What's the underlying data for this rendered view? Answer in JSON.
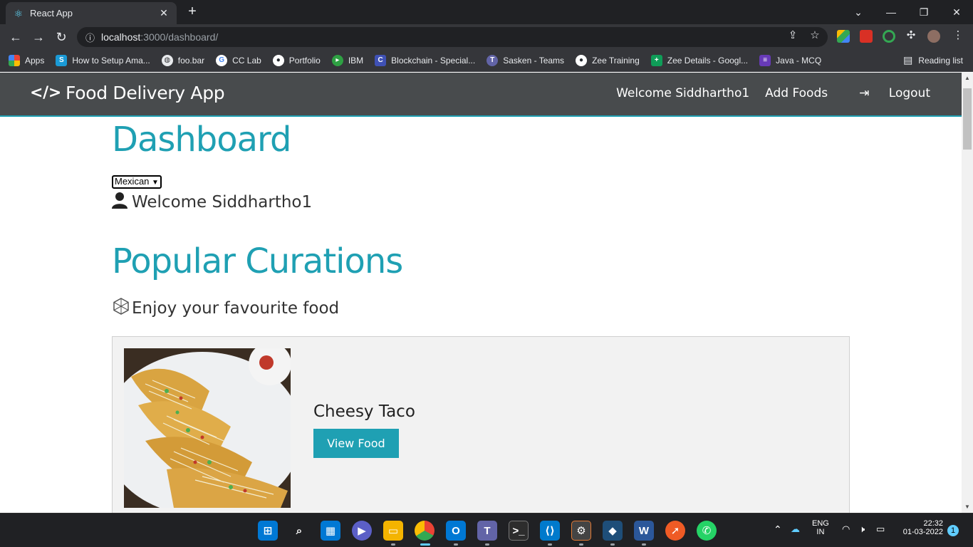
{
  "browser": {
    "tab_title": "React App",
    "tab_close": "✕",
    "new_tab": "+",
    "url_host": "localhost",
    "url_rest": ":3000/dashboard/",
    "bookmarks": [
      {
        "label": "Apps",
        "color": "#ea4335"
      },
      {
        "label": "How to Setup Ama...",
        "color": "#1a9ad6"
      },
      {
        "label": "foo.bar",
        "color": "#5f6368"
      },
      {
        "label": "CC Lab",
        "color": "#4285f4"
      },
      {
        "label": "Portfolio",
        "color": "#24292e"
      },
      {
        "label": "IBM",
        "color": "#2ea043"
      },
      {
        "label": "Blockchain - Special...",
        "color": "#3f51b5"
      },
      {
        "label": "Sasken - Teams",
        "color": "#6264a7"
      },
      {
        "label": "Zee Training",
        "color": "#24292e"
      },
      {
        "label": "Zee Details - Googl...",
        "color": "#0f9d58"
      },
      {
        "label": "Java - MCQ",
        "color": "#673ab7"
      }
    ],
    "reading_list": "Reading list"
  },
  "app": {
    "brand": "Food Delivery App",
    "brand_icon": "</>",
    "nav": {
      "welcome": "Welcome Siddhartho1",
      "add_foods": "Add Foods",
      "logout": "Logout"
    }
  },
  "dashboard": {
    "title": "Dashboard",
    "cuisine_selected": "Mexican",
    "welcome": "Welcome Siddhartho1",
    "popular_title": "Popular Curations",
    "subtitle": "Enjoy your favourite food"
  },
  "food_card": {
    "name": "Cheesy Taco",
    "button": "View Food"
  },
  "taskbar": {
    "lang_top": "ENG",
    "lang_bottom": "IN",
    "time": "22:32",
    "date": "01-03-2022",
    "notifications": "1"
  },
  "colors": {
    "accent": "#1fa0b3",
    "navbar": "#484b4d"
  }
}
